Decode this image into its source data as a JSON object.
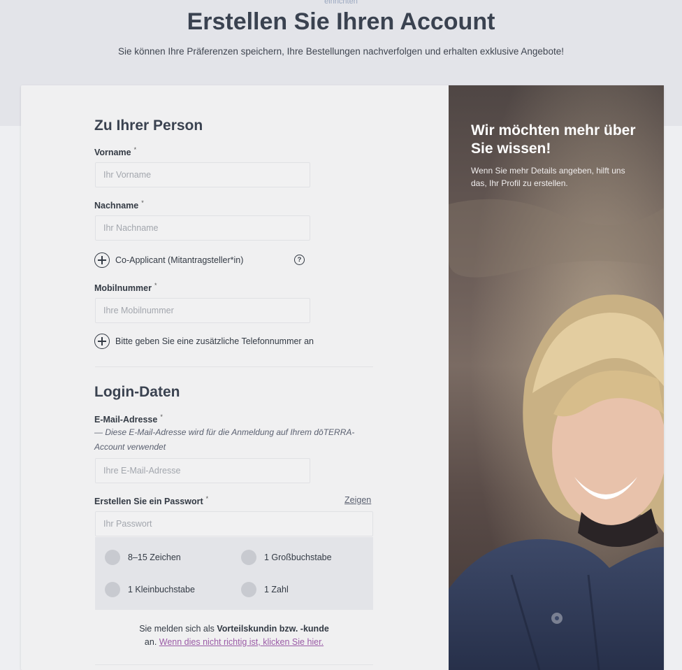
{
  "header": {
    "top_cut_text": "einrichten",
    "title": "Erstellen Sie Ihren Account",
    "subtitle": "Sie können Ihre Präferenzen speichern, Ihre Bestellungen nachverfolgen und erhalten exklusive Angebote!"
  },
  "personal": {
    "title": "Zu Ihrer Person",
    "firstname": {
      "label": "Vorname",
      "required_mark": "*",
      "placeholder": "Ihr Vorname"
    },
    "lastname": {
      "label": "Nachname",
      "required_mark": "*",
      "placeholder": "Ihr Nachname"
    },
    "co_applicant_label": "Co-Applicant (Mitantragsteller*in)",
    "mobile": {
      "label": "Mobilnummer",
      "required_mark": "*",
      "placeholder": "Ihre Mobilnummer"
    },
    "add_phone_label": "Bitte geben Sie eine zusätzliche Telefonnummer an"
  },
  "login": {
    "title": "Login-Daten",
    "email": {
      "label": "E-Mail-Adresse",
      "required_mark": "*",
      "hint": "— Diese E-Mail-Adresse wird für die Anmeldung auf Ihrem dōTERRA-Account verwendet",
      "placeholder": "Ihre E-Mail-Adresse"
    },
    "password": {
      "label": "Erstellen Sie ein Passwort",
      "required_mark": "*",
      "show_label": "Zeigen",
      "placeholder": "Ihr Passwort"
    },
    "requirements": [
      "8–15 Zeichen",
      "1 Großbuchstabe",
      "1 Kleinbuchstabe",
      "1 Zahl"
    ]
  },
  "status": {
    "prefix": "Sie melden sich als ",
    "bold": "Vorteilskundin bzw. -kunde",
    "line2_prefix": "an. ",
    "link": "Wenn dies nicht richtig ist, klicken Sie hier."
  },
  "aside": {
    "title": "Wir möchten mehr über Sie wissen!",
    "text": "Wenn Sie mehr Details angeben, hilft uns das, Ihr Profil zu erstellen."
  }
}
